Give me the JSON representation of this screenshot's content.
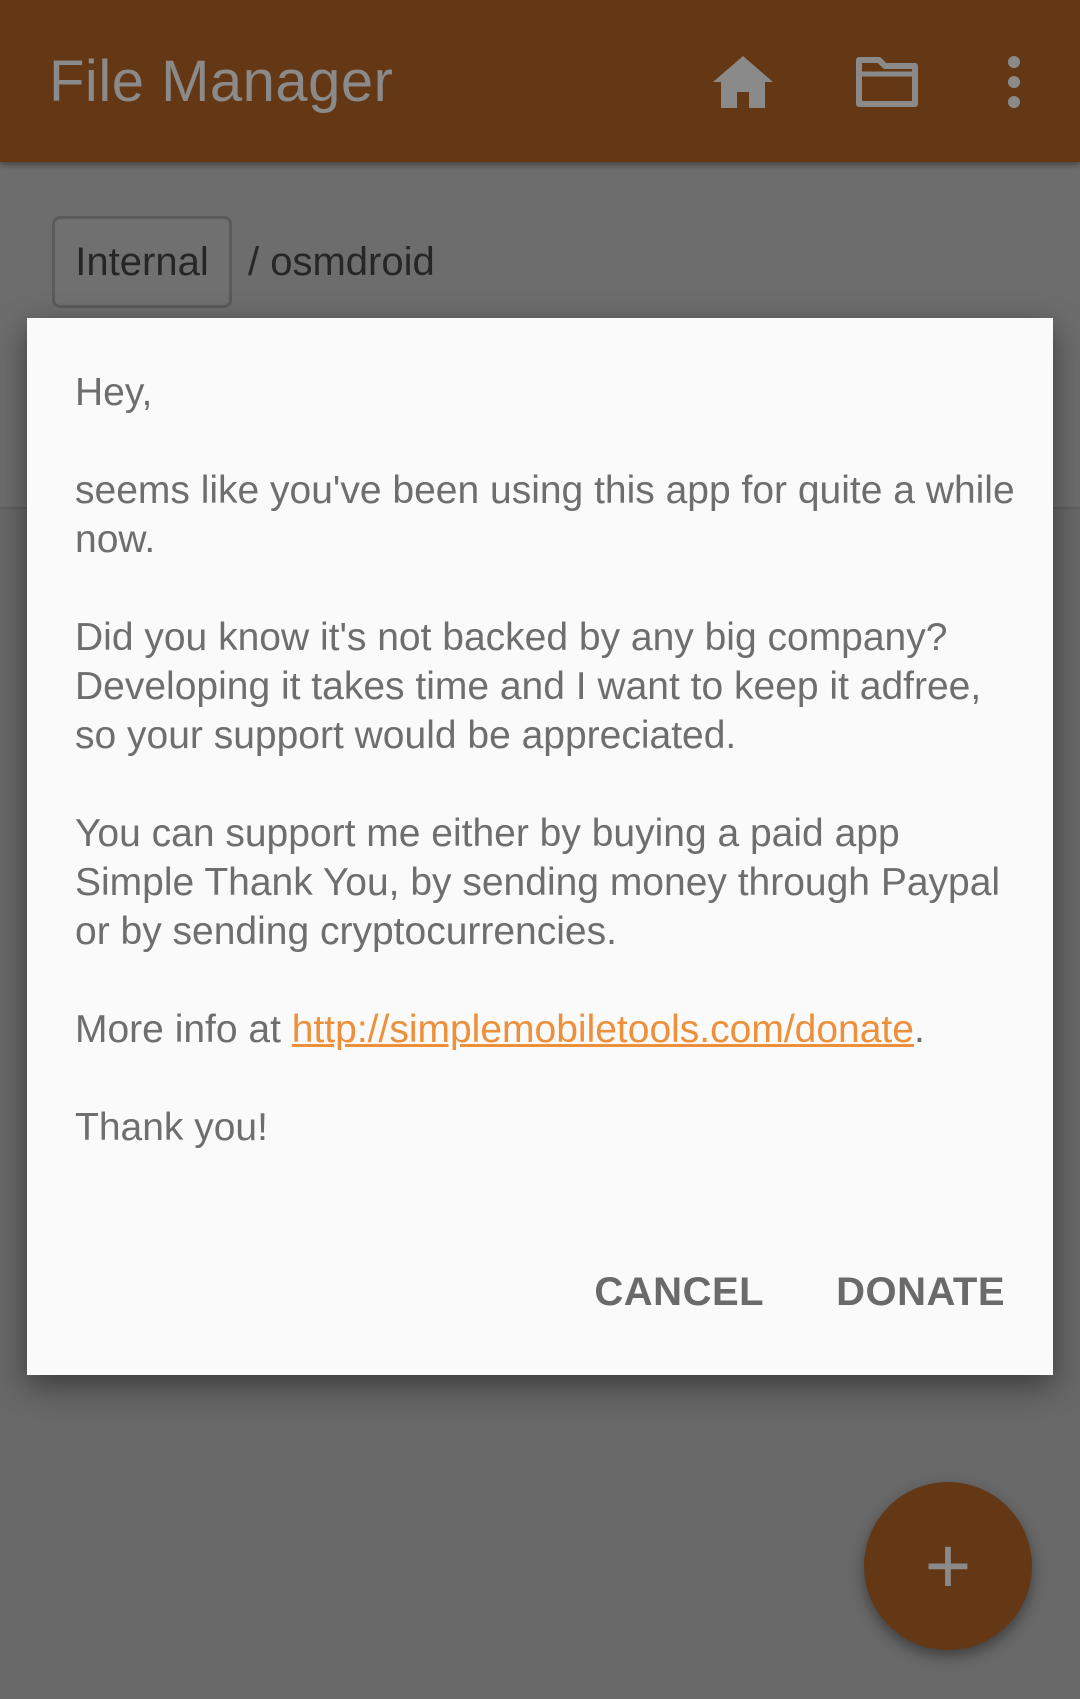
{
  "toolbar": {
    "title": "File Manager",
    "icons": [
      "home-icon",
      "folder-icon",
      "more-vert-icon"
    ]
  },
  "breadcrumbs": {
    "root": "Internal",
    "path": "/ osmdroid"
  },
  "dialog": {
    "greeting": "Hey,",
    "paragraph1": "seems like you've been using this app for quite a while now.",
    "paragraph2": "Did you know it's not backed by any big company? Developing it takes time and I want to keep it adfree, so your support would be appreciated.",
    "paragraph3": "You can support me either by buying a paid app Simple Thank You, by sending money through Paypal or by sending cryptocurrencies.",
    "more_info_prefix": "More info at ",
    "more_info_link": "http://simplemobiletools.com/donate",
    "more_info_suffix": ".",
    "closing": "Thank you!",
    "cancel_label": "CANCEL",
    "donate_label": "DONATE"
  },
  "fab": {
    "icon": "plus-icon",
    "symbol": "+"
  },
  "colors": {
    "accent": "#ee8f3a",
    "primary_dimmed": "#643815",
    "dialog_bg": "#fafafa",
    "scrim": "#686868"
  }
}
